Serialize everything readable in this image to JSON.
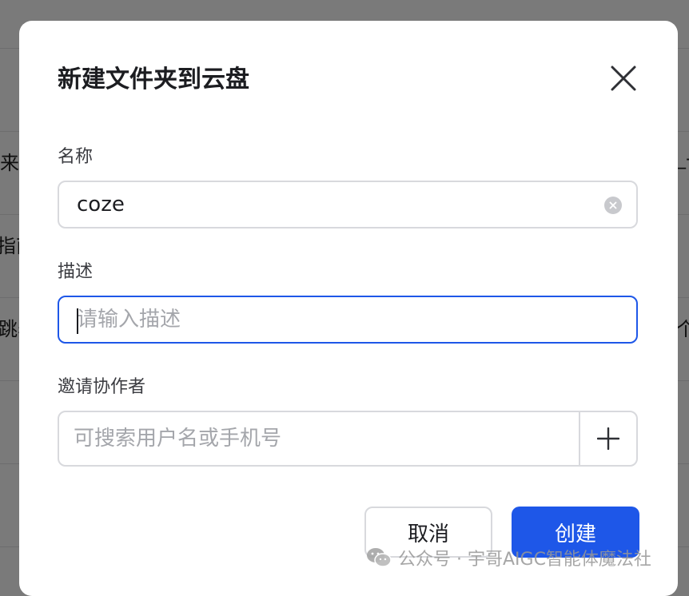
{
  "background": {
    "fragments": [
      "来",
      "指南",
      "跳表",
      "_-",
      "个"
    ]
  },
  "dialog": {
    "title": "新建文件夹到云盘",
    "close_icon": "close-icon",
    "name_field": {
      "label": "名称",
      "value": "coze",
      "clear_icon": "clear-circle-icon"
    },
    "description_field": {
      "label": "描述",
      "value": "",
      "placeholder": "请输入描述"
    },
    "collaborators_field": {
      "label": "邀请协作者",
      "value": "",
      "placeholder": "可搜索用户名或手机号",
      "add_icon": "plus-icon"
    },
    "cancel_label": "取消",
    "create_label": "创建"
  },
  "watermark": {
    "text": "公众号 · 宇哥AIGC智能体魔法社",
    "icon": "wechat-icon"
  },
  "colors": {
    "primary": "#1e57e8",
    "overlay": "rgba(0,0,0,0.52)",
    "border": "#d8d9dd",
    "text": "#1c1d21",
    "placeholder": "#a4a6ab"
  }
}
